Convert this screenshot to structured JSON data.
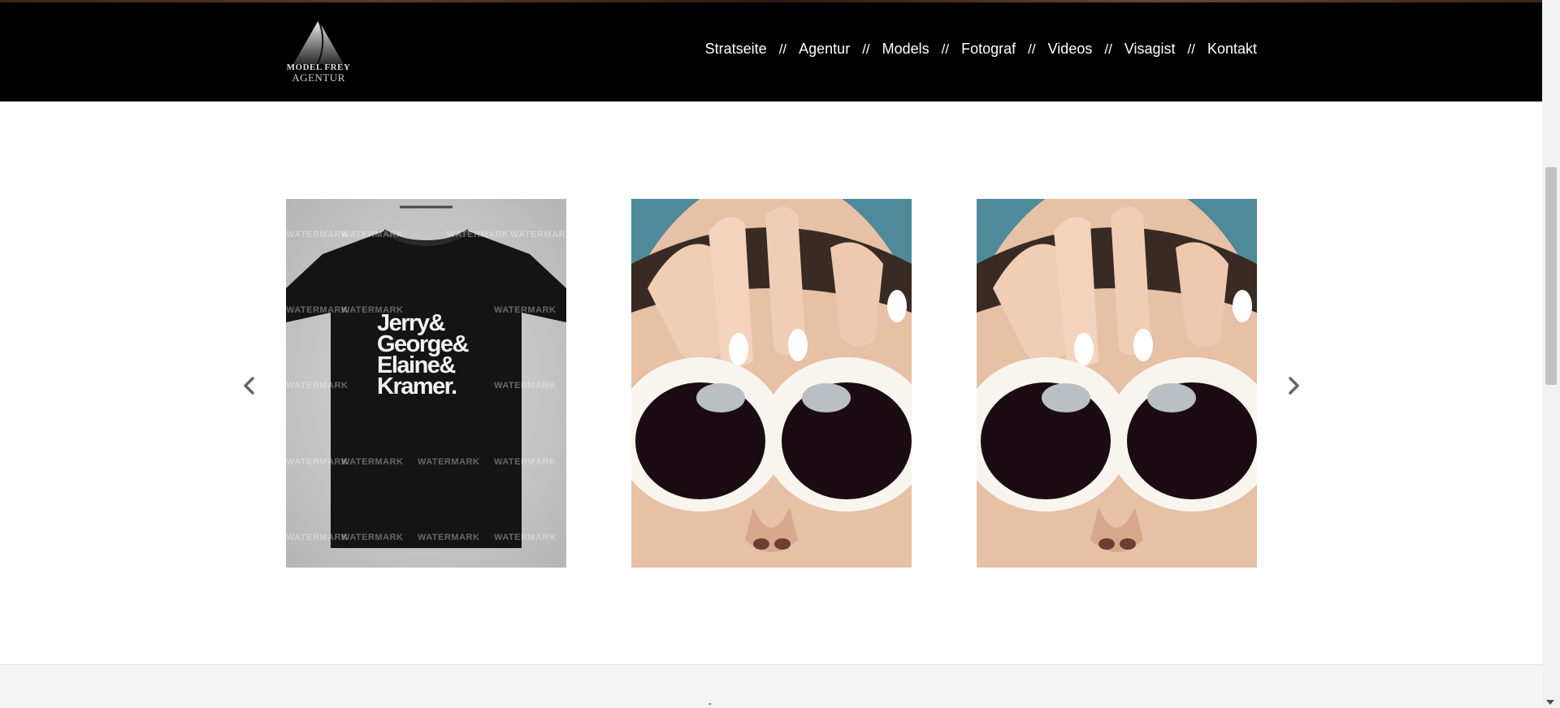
{
  "header": {
    "logo": {
      "line1": "MODEL FREY",
      "line2": "AGENTUR",
      "icon": "triangle-logo-icon"
    },
    "nav": {
      "separator": "//",
      "items": [
        {
          "label": "Stratseite"
        },
        {
          "label": "Agentur"
        },
        {
          "label": "Models"
        },
        {
          "label": "Fotograf"
        },
        {
          "label": "Videos"
        },
        {
          "label": "Visagist"
        },
        {
          "label": "Kontakt"
        }
      ]
    }
  },
  "carousel": {
    "prev_icon": "chevron-left-icon",
    "next_icon": "chevron-right-icon",
    "slides": [
      {
        "image": "tshirt-product-image",
        "watermark": "WATERMARK",
        "shirt_lines": [
          "Jerry&",
          "George&",
          "Elaine&",
          "Kramer."
        ]
      },
      {
        "image": "woman-white-sunglasses-image"
      },
      {
        "image": "woman-white-sunglasses-image"
      }
    ]
  },
  "footer": {
    "mark": "\""
  },
  "colors": {
    "header_bg": "#000000",
    "nav_text": "#ffffff",
    "page_bg": "#ffffff",
    "footer_bg": "#f5f5f5",
    "arrow": "#666666"
  }
}
